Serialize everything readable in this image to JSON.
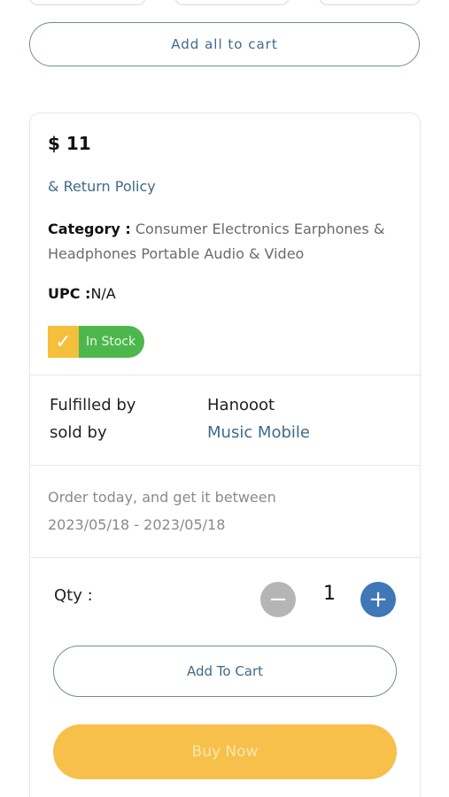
{
  "bundle": {
    "add_all_label": "Add all to cart"
  },
  "product": {
    "price": "$ 11",
    "return_policy": "& Return Policy",
    "category_label": "Category :",
    "category_value": "Consumer Electronics Earphones & Headphones Portable Audio & Video",
    "upc_label": "UPC :",
    "upc_value": "N/A",
    "stock_status": "In Stock"
  },
  "fulfillment": {
    "fulfilled_label": "Fulfilled by",
    "fulfilled_value": "Hanooot",
    "sold_label": "sold by",
    "sold_value": "Music Mobile"
  },
  "delivery": {
    "text": "Order today, and get it between",
    "range": "2023/05/18 - 2023/05/18"
  },
  "quantity": {
    "label": "Qty :",
    "value": "1",
    "minus_icon": "minus-icon",
    "plus_icon": "plus-icon"
  },
  "actions": {
    "add_to_cart": "Add To Cart",
    "buy_now": "Buy Now"
  },
  "colors": {
    "accent_blue": "#3f77b7",
    "link": "#3f6b8a",
    "in_stock_green": "#4cb84c",
    "check_yellow": "#f4bf3b",
    "buy_now": "#f6c04a"
  }
}
